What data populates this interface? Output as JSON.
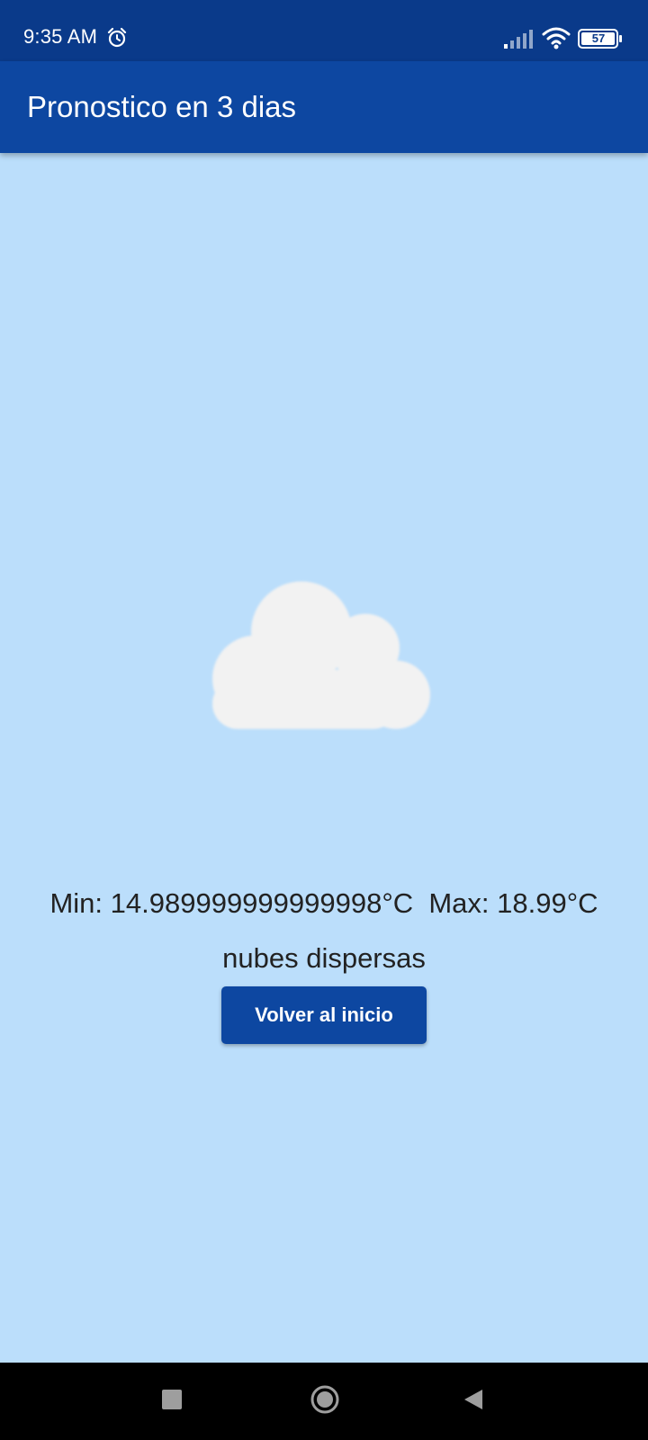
{
  "status_bar": {
    "time": "9:35 AM",
    "battery": "57",
    "icons": [
      "alarm-icon",
      "signal-icon",
      "wifi-icon",
      "battery-icon"
    ]
  },
  "app_bar": {
    "title": "Pronostico en 3 dias"
  },
  "forecast": {
    "icon": "cloud-icon",
    "temperature_line": "Min: 14.989999999999998°C  Max: 18.99°C",
    "description": "nubes dispersas"
  },
  "actions": {
    "back_label": "Volver al inicio"
  },
  "nav_bar": {
    "icons": [
      "recents-icon",
      "home-icon",
      "back-icon"
    ]
  },
  "colors": {
    "status_bar": "#0a3a8a",
    "app_bar": "#0d47a1",
    "background": "#bbdefb",
    "button": "#0d47a1",
    "cloud": "#f2f2f2"
  }
}
